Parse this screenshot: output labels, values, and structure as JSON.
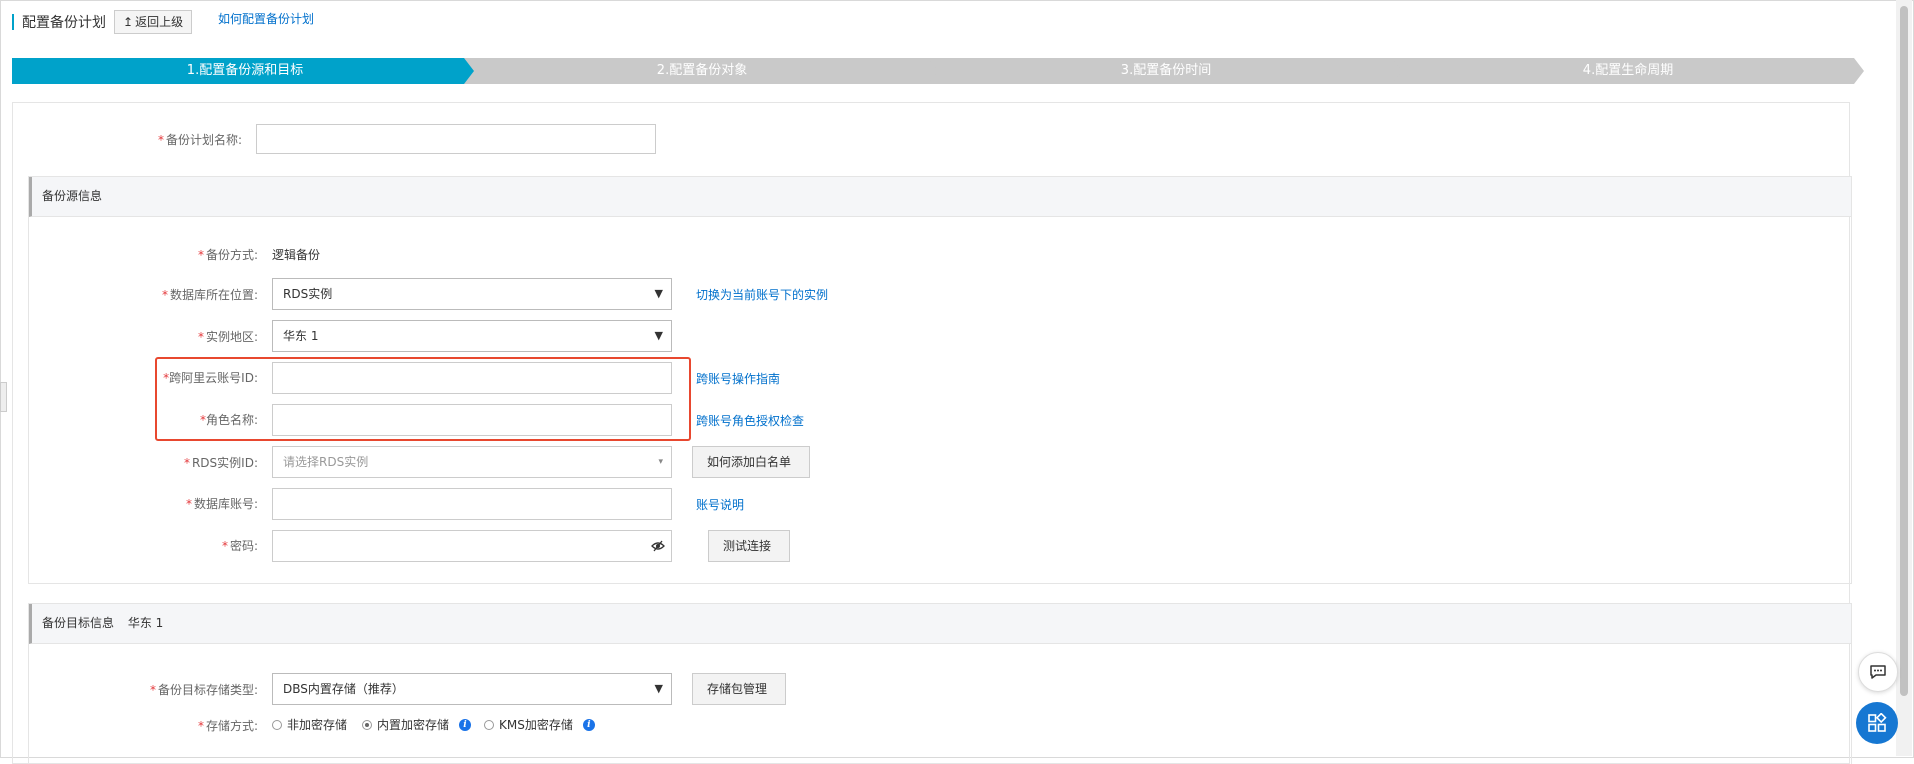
{
  "header": {
    "title": "配置备份计划",
    "back_label": "返回上级",
    "back_icon": "↥",
    "help_link": "如何配置备份计划"
  },
  "steps": [
    {
      "label": "1.配置备份源和目标",
      "active": true
    },
    {
      "label": "2.配置备份对象",
      "active": false
    },
    {
      "label": "3.配置备份时间",
      "active": false
    },
    {
      "label": "4.配置生命周期",
      "active": false
    }
  ],
  "colors": {
    "accent": "#00a2ca",
    "step_inactive": "#c9c9c9",
    "link": "#0070cc",
    "highlight": "#e8482f",
    "required": "#e4393c"
  },
  "plan": {
    "name_label": "备份计划名称:",
    "name_value": ""
  },
  "source": {
    "section_title": "备份源信息",
    "method_label": "备份方式:",
    "method_value": "逻辑备份",
    "location_label": "数据库所在位置:",
    "location_value": "RDS实例",
    "location_link": "切换为当前账号下的实例",
    "region_label": "实例地区:",
    "region_value": "华东 1",
    "cross_id_label": "跨阿里云账号ID:",
    "cross_id_value": "",
    "cross_id_link": "跨账号操作指南",
    "role_label": "角色名称:",
    "role_value": "",
    "role_link": "跨账号角色授权检查",
    "rds_label": "RDS实例ID:",
    "rds_placeholder": "请选择RDS实例",
    "rds_button": "如何添加白名单",
    "account_label": "数据库账号:",
    "account_value": "",
    "account_link": "账号说明",
    "password_label": "密码:",
    "password_value": "",
    "test_button": "测试连接"
  },
  "target": {
    "section_title": "备份目标信息",
    "section_region": "华东 1",
    "storage_type_label": "备份目标存储类型:",
    "storage_type_value": "DBS内置存储（推荐）",
    "storage_button": "存储包管理",
    "storage_mode_label": "存储方式:",
    "storage_mode_options": [
      {
        "label": "非加密存储",
        "selected": false
      },
      {
        "label": "内置加密存储",
        "selected": true,
        "info": true
      },
      {
        "label": "KMS加密存储",
        "selected": false,
        "info": true
      }
    ]
  },
  "icons": {
    "dropdown": "▼",
    "eye": "eye-slash-icon",
    "chat": "chat-icon",
    "apps": "apps-icon"
  }
}
